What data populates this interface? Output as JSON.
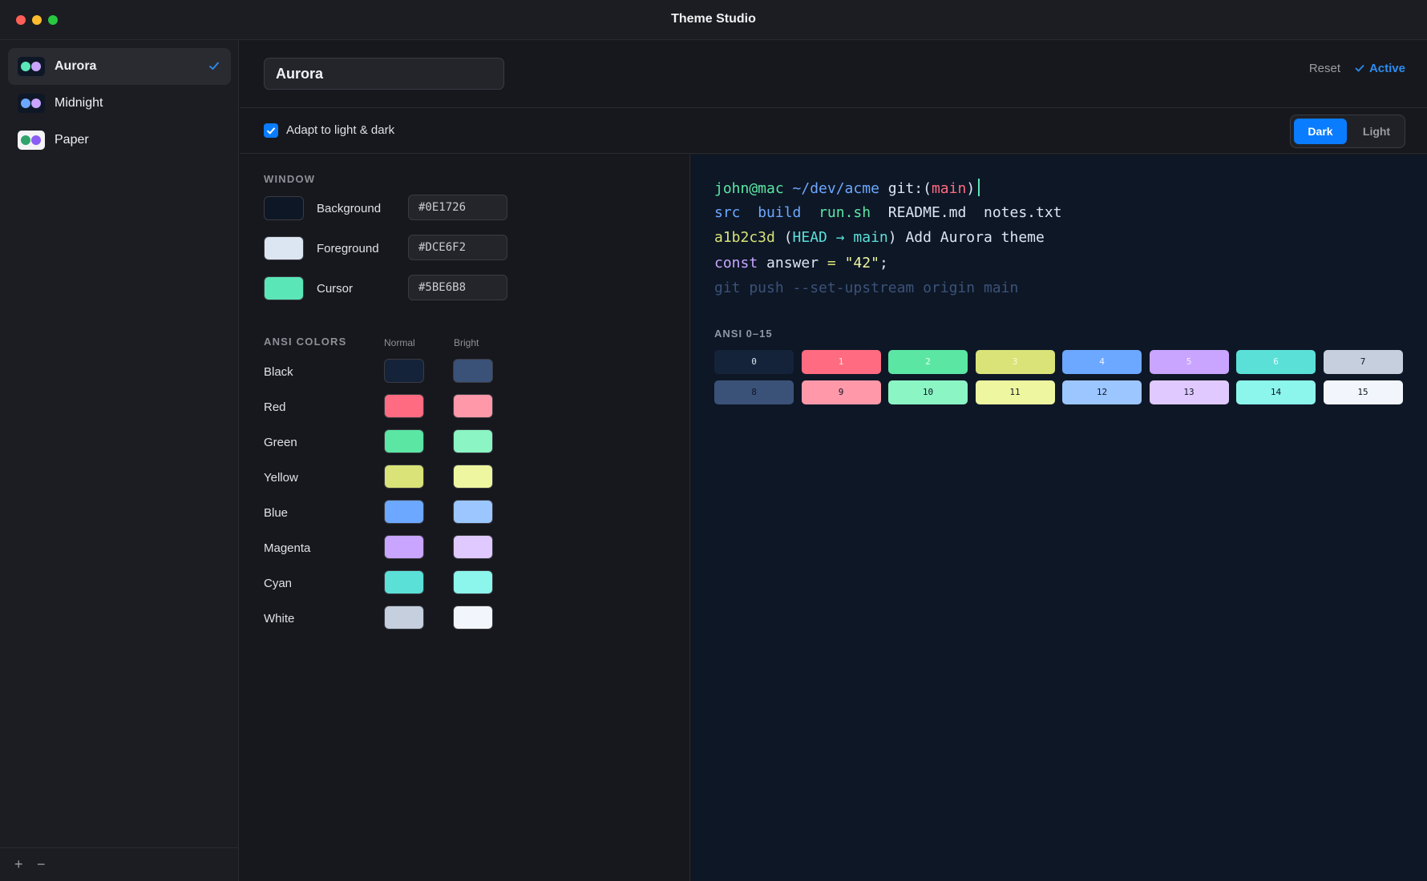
{
  "app": {
    "title": "Theme Studio"
  },
  "sidebar": {
    "themes": [
      {
        "name": "Aurora",
        "selected": true,
        "dot_colors": [
          "#5BE6B8",
          "#C9A5FF"
        ]
      },
      {
        "name": "Midnight",
        "selected": false,
        "dot_colors": [
          "#6CA8FF",
          "#C9A5FF"
        ]
      },
      {
        "name": "Paper",
        "selected": false,
        "dot_colors": [
          "#2FA36B",
          "#8B5CF6"
        ]
      }
    ],
    "footer": {
      "add": "+",
      "remove": "−"
    }
  },
  "header": {
    "theme_name": "Aurora",
    "reset_label": "Reset",
    "active_label": "Active"
  },
  "options": {
    "adapt_label": "Adapt to light & dark",
    "adapt_checked": true,
    "mode_dark": "Dark",
    "mode_light": "Light",
    "mode_selected": "Dark"
  },
  "window_section": {
    "title": "WINDOW",
    "rows": [
      {
        "label": "Background",
        "hex": "#0E1726"
      },
      {
        "label": "Foreground",
        "hex": "#DCE6F2"
      },
      {
        "label": "Cursor",
        "hex": "#5BE6B8"
      }
    ]
  },
  "ansi_section": {
    "title": "ANSI COLORS",
    "col_normal": "Normal",
    "col_bright": "Bright",
    "rows": [
      {
        "label": "Black",
        "normal": "#15233A",
        "bright": "#3B5278"
      },
      {
        "label": "Red",
        "normal": "#FF6B81",
        "bright": "#FF98A8"
      },
      {
        "label": "Green",
        "normal": "#5BE6A4",
        "bright": "#8BF5C4"
      },
      {
        "label": "Yellow",
        "normal": "#D9E377",
        "bright": "#EEF7A0"
      },
      {
        "label": "Blue",
        "normal": "#6CA8FF",
        "bright": "#9CC6FF"
      },
      {
        "label": "Magenta",
        "normal": "#C9A5FF",
        "bright": "#E0C9FF"
      },
      {
        "label": "Cyan",
        "normal": "#5BE0D8",
        "bright": "#8CF5EC"
      },
      {
        "label": "White",
        "normal": "#C5CFDD",
        "bright": "#F2F6FC"
      }
    ]
  },
  "preview": {
    "lines": [
      [
        {
          "t": "john@mac",
          "c": "#5BE6A4"
        },
        {
          "t": " ~/dev/acme",
          "c": "#6CA8FF"
        },
        {
          "t": " git:(",
          "c": "#DCE6F2"
        },
        {
          "t": "main",
          "c": "#FF6B81"
        },
        {
          "t": ")",
          "c": "#DCE6F2"
        }
      ],
      [
        {
          "t": "src",
          "c": "#6CA8FF"
        },
        {
          "t": "  ",
          "c": "#DCE6F2"
        },
        {
          "t": "build",
          "c": "#6CA8FF"
        },
        {
          "t": "  ",
          "c": "#DCE6F2"
        },
        {
          "t": "run.sh",
          "c": "#5BE6A4"
        },
        {
          "t": "  README.md  notes.txt",
          "c": "#DCE6F2"
        }
      ],
      [
        {
          "t": "a1b2c3d",
          "c": "#D9E377"
        },
        {
          "t": " (",
          "c": "#DCE6F2"
        },
        {
          "t": "HEAD → main",
          "c": "#5BE0D8"
        },
        {
          "t": ") Add Aurora theme",
          "c": "#DCE6F2"
        }
      ],
      [
        {
          "t": "const",
          "c": "#C9A5FF"
        },
        {
          "t": " answer ",
          "c": "#DCE6F2"
        },
        {
          "t": "=",
          "c": "#D9E377"
        },
        {
          "t": " ",
          "c": "#DCE6F2"
        },
        {
          "t": "\"42\"",
          "c": "#EEF7A0"
        },
        {
          "t": ";",
          "c": "#DCE6F2"
        }
      ],
      [
        {
          "t": "git push --set-upstream origin main",
          "c": "#3B5278"
        }
      ]
    ],
    "ansi_title": "ANSI 0–15",
    "chips": [
      {
        "n": "0",
        "bg": "#15233A",
        "fg": "#DCE6F2"
      },
      {
        "n": "1",
        "bg": "#FF6B81",
        "fg": "#FFE4E9"
      },
      {
        "n": "2",
        "bg": "#5BE6A4",
        "fg": "#E8FFF5"
      },
      {
        "n": "3",
        "bg": "#D9E377",
        "fg": "#F7FAD9"
      },
      {
        "n": "4",
        "bg": "#6CA8FF",
        "fg": "#EAF3FF"
      },
      {
        "n": "5",
        "bg": "#C9A5FF",
        "fg": "#F6EEFF"
      },
      {
        "n": "6",
        "bg": "#5BE0D8",
        "fg": "#E6FFFC"
      },
      {
        "n": "7",
        "bg": "#C5CFDD",
        "fg": "#0E1726"
      },
      {
        "n": "8",
        "bg": "#3B5278",
        "fg": "#0E1726"
      },
      {
        "n": "9",
        "bg": "#FF98A8",
        "fg": "#0E1726"
      },
      {
        "n": "10",
        "bg": "#8BF5C4",
        "fg": "#0E1726"
      },
      {
        "n": "11",
        "bg": "#EEF7A0",
        "fg": "#0E1726"
      },
      {
        "n": "12",
        "bg": "#9CC6FF",
        "fg": "#0E1726"
      },
      {
        "n": "13",
        "bg": "#E0C9FF",
        "fg": "#0E1726"
      },
      {
        "n": "14",
        "bg": "#8CF5EC",
        "fg": "#0E1726"
      },
      {
        "n": "15",
        "bg": "#F2F6FC",
        "fg": "#0E1726"
      }
    ]
  }
}
